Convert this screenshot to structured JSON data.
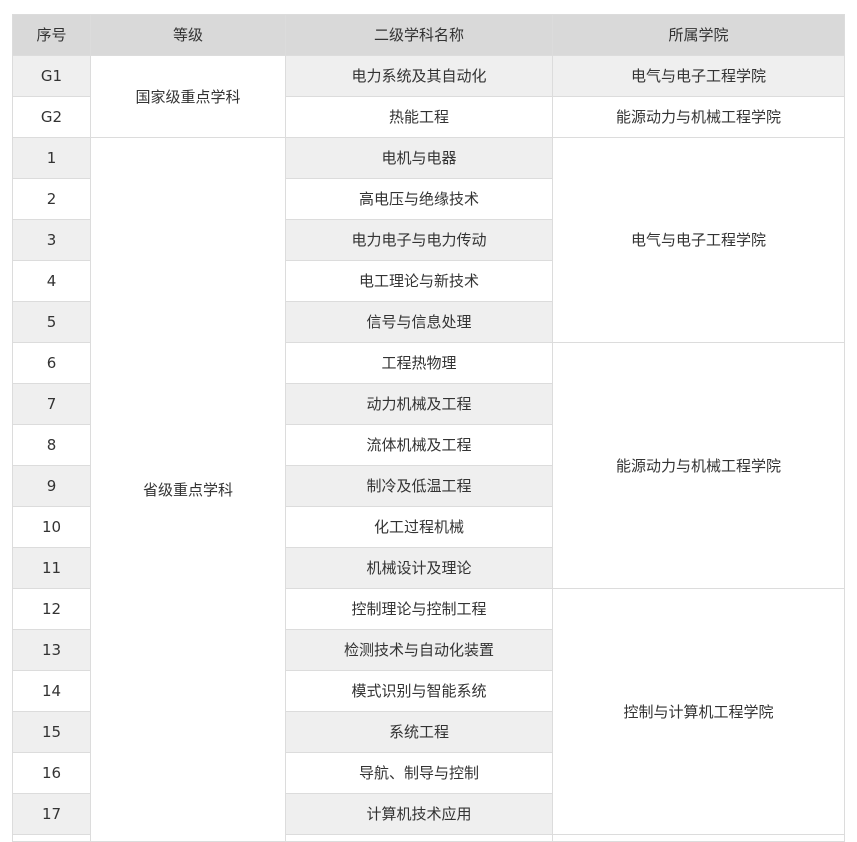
{
  "table": {
    "headers": [
      "序号",
      "等级",
      "二级学科名称",
      "所属学院"
    ],
    "rows": [
      {
        "num": "G1",
        "subject": "电力系统及其自动化",
        "level": "国家级重点学科",
        "college": "电气与电子工程学院"
      },
      {
        "num": "G2",
        "subject": "热能工程",
        "college": "能源动力与机械工程学院"
      },
      {
        "num": "1",
        "subject": "电机与电器",
        "level": "省级重点学科",
        "college": "电气与电子工程学院"
      },
      {
        "num": "2",
        "subject": "高电压与绝缘技术"
      },
      {
        "num": "3",
        "subject": "电力电子与电力传动"
      },
      {
        "num": "4",
        "subject": "电工理论与新技术"
      },
      {
        "num": "5",
        "subject": "信号与信息处理"
      },
      {
        "num": "6",
        "subject": "工程热物理",
        "college": "能源动力与机械工程学院"
      },
      {
        "num": "7",
        "subject": "动力机械及工程"
      },
      {
        "num": "8",
        "subject": "流体机械及工程"
      },
      {
        "num": "9",
        "subject": "制冷及低温工程"
      },
      {
        "num": "10",
        "subject": "化工过程机械"
      },
      {
        "num": "11",
        "subject": "机械设计及理论"
      },
      {
        "num": "12",
        "subject": "控制理论与控制工程",
        "college": "控制与计算机工程学院"
      },
      {
        "num": "13",
        "subject": "检测技术与自动化装置"
      },
      {
        "num": "14",
        "subject": "模式识别与智能系统"
      },
      {
        "num": "15",
        "subject": "系统工程"
      },
      {
        "num": "16",
        "subject": "导航、制导与控制"
      },
      {
        "num": "17",
        "subject": "计算机技术应用"
      }
    ]
  }
}
